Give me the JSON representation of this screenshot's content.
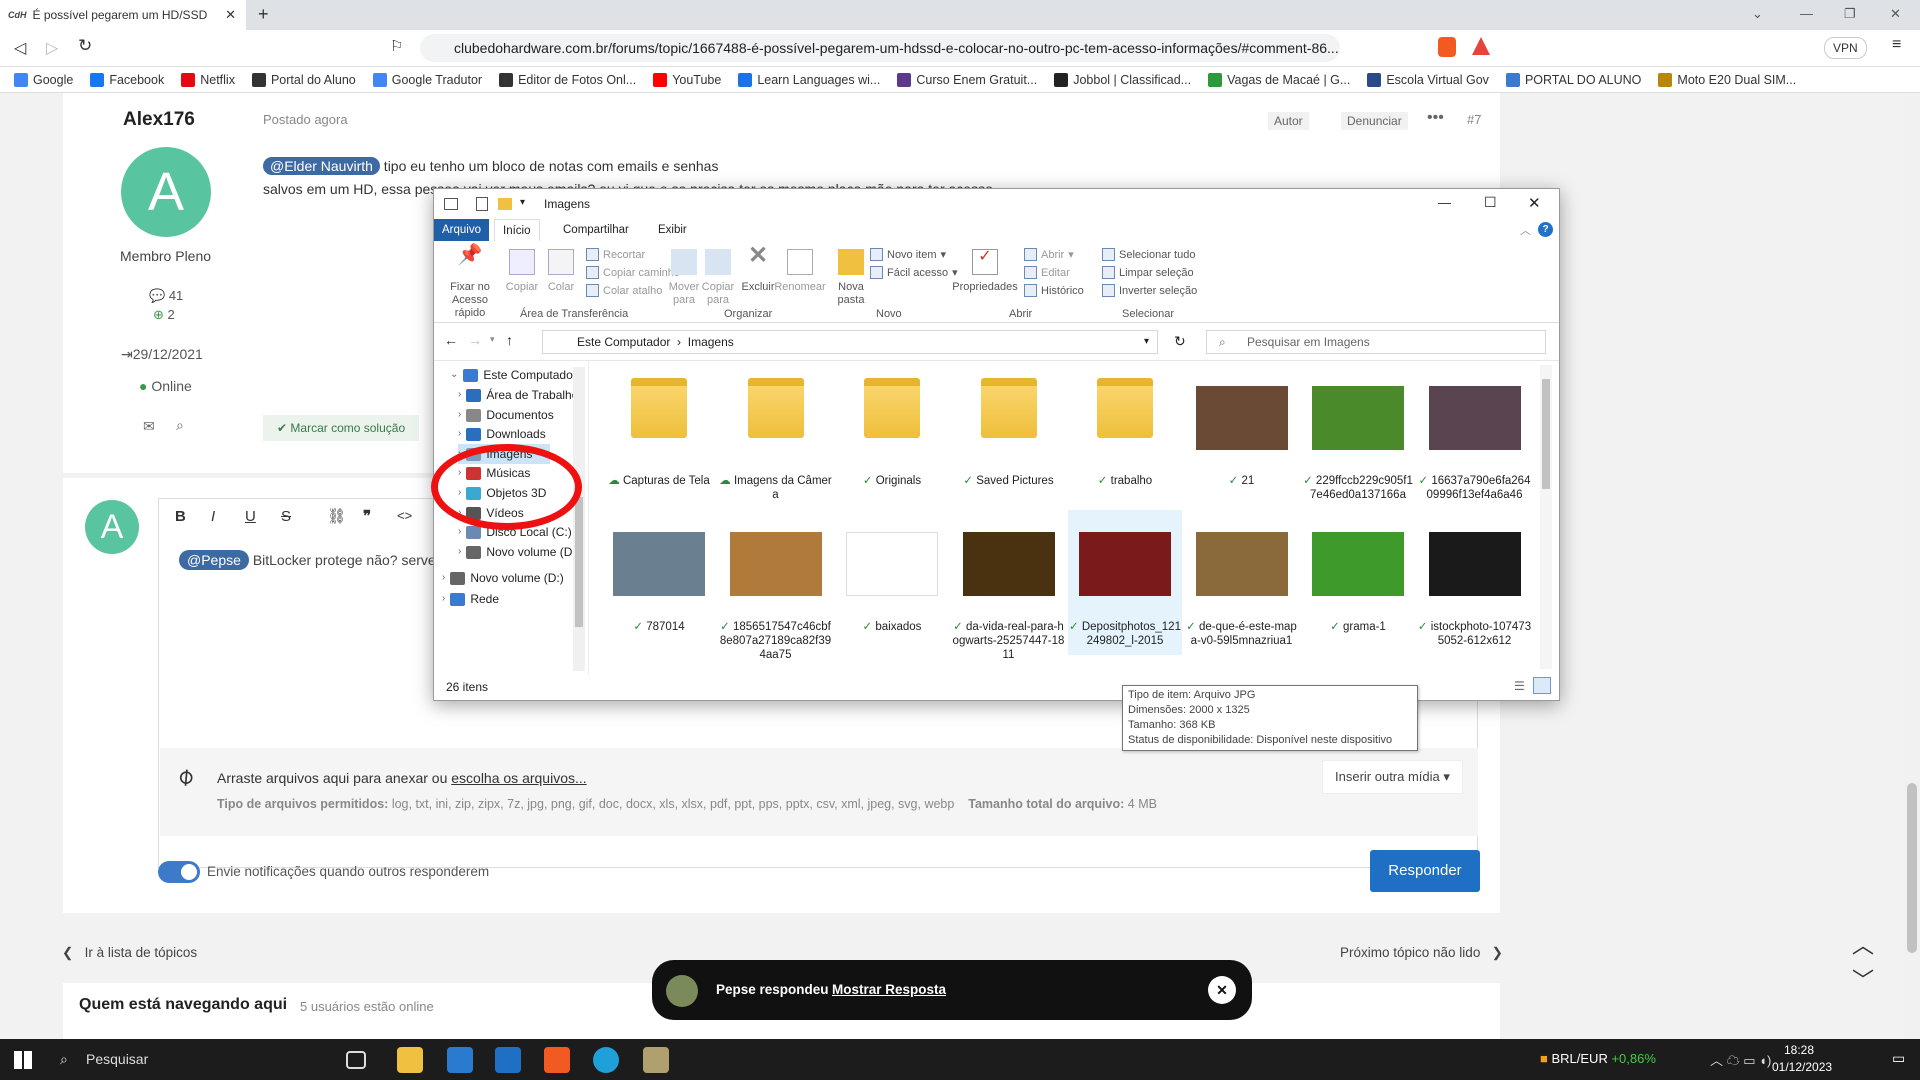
{
  "browser": {
    "tab_title": "É possível pegarem um HD/SSD",
    "favicon": "CdH",
    "url": "clubedohardware.com.br/forums/topic/1667488-é-possível-pegarem-um-hdssd-e-colocar-no-outro-pc-tem-acesso-informações/#comment-86...",
    "vpn": "VPN",
    "bookmarks": [
      "Google",
      "Facebook",
      "Netflix",
      "Portal do Aluno",
      "Google Tradutor",
      "Editor de Fotos Onl...",
      "YouTube",
      "Learn Languages wi...",
      "Curso Enem Gratuit...",
      "Jobbol | Classificad...",
      "Vagas de Macaé | G...",
      "Escola Virtual Gov",
      "PORTAL DO ALUNO",
      "Moto E20 Dual SIM..."
    ]
  },
  "post": {
    "author": "Alex176",
    "avatar_letter": "A",
    "role": "Membro Pleno",
    "posts": "41",
    "reputation": "2",
    "joined": "29/12/2021",
    "status": "Online",
    "posted": "Postado agora",
    "author_badge": "Autor",
    "report": "Denunciar",
    "number": "#7",
    "mention": "@Elder Nauvirth",
    "line1": " tipo eu tenho um bloco de notas com emails e senhas",
    "line2": "salvos em um HD, essa pessoa vai ver meus emails? ou vi que e so precisa ter os mesmo placa mãe para ter acesso",
    "solution_btn": "Marcar como solução"
  },
  "reply": {
    "avatar_letter": "A",
    "mention": "@Pepse",
    "text": "BitLocker protege não? serve",
    "attach_text": "Arraste arquivos aqui para anexar ou ",
    "attach_link": "escolha os arquivos...",
    "allowed_label": "Tipo de arquivos permitidos:",
    "allowed": "log, txt, ini, zip, zipx, 7z, jpg, png, gif, doc, docx, xls, xlsx, pdf, ppt, pps, pptx, csv, xml, jpeg, svg, webp",
    "size_label": "Tamanho total do arquivo:",
    "size": "4 MB",
    "insert_media": "Inserir outra mídia",
    "notify": "Envie notificações quando outros responderem",
    "submit": "Responder"
  },
  "footer_nav": {
    "back": "Ir à lista de tópicos",
    "next": "Próximo tópico não lido"
  },
  "browsing": {
    "title": "Quem está navegando aqui",
    "count": "5 usuários estão online"
  },
  "toast": {
    "text": "Pepse respondeu",
    "link": "Mostrar Resposta"
  },
  "explorer": {
    "title": "Imagens",
    "tabs": [
      "Arquivo",
      "Início",
      "Compartilhar",
      "Exibir"
    ],
    "ribbon": {
      "pin": "Fixar no Acesso rápido",
      "copy": "Copiar",
      "paste": "Colar",
      "cut": "Recortar",
      "copy_path": "Copiar caminho",
      "paste_shortcut": "Colar atalho",
      "clipboard": "Área de Transferência",
      "move": "Mover para",
      "copyto": "Copiar para",
      "delete": "Excluir",
      "rename": "Renomear",
      "organize": "Organizar",
      "newfolder": "Nova pasta",
      "newitem": "Novo item",
      "easy": "Fácil acesso",
      "new": "Novo",
      "props": "Propriedades",
      "open": "Abrir",
      "edit": "Editar",
      "history": "Histórico",
      "open_grp": "Abrir",
      "selall": "Selecionar tudo",
      "selnone": "Limpar seleção",
      "selinv": "Inverter seleção",
      "select": "Selecionar"
    },
    "crumbs": [
      "Este Computador",
      "Imagens"
    ],
    "search": "Pesquisar em Imagens",
    "tree": [
      "Este Computador",
      "Área de Trabalho",
      "Documentos",
      "Downloads",
      "Imagens",
      "Músicas",
      "Objetos 3D",
      "Vídeos",
      "Disco Local (C:)",
      "Novo volume (D:",
      "Novo volume (D:)",
      "Rede"
    ],
    "items": [
      {
        "name": "Capturas de Tela",
        "kind": "folder"
      },
      {
        "name": "Imagens da Câmera",
        "kind": "folder"
      },
      {
        "name": "Originals",
        "kind": "folder"
      },
      {
        "name": "Saved Pictures",
        "kind": "folder"
      },
      {
        "name": "trabalho",
        "kind": "folder"
      },
      {
        "name": "21",
        "kind": "photo",
        "color": "#6b4a35"
      },
      {
        "name": "229ffccb229c905f17e46ed0a137166a",
        "kind": "photo",
        "color": "#4a8a2a"
      },
      {
        "name": "16637a790e6fa26409996f13ef4a6a46",
        "kind": "photo",
        "color": "#5a4450"
      },
      {
        "name": "787014",
        "kind": "photo",
        "color": "#6a7f90"
      },
      {
        "name": "1856517547c46cbf8e807a27189ca82f394aa75",
        "kind": "photo",
        "color": "#b07a3a"
      },
      {
        "name": "baixados",
        "kind": "photo",
        "color": "#ffffff"
      },
      {
        "name": "da-vida-real-para-hogwarts-25257447-1811",
        "kind": "photo",
        "color": "#4a3210"
      },
      {
        "name": "Depositphotos_121249802_l-2015",
        "kind": "photo",
        "color": "#7a1a1a"
      },
      {
        "name": "de-que-é-este-mapa-v0-59l5mnazriua1",
        "kind": "photo",
        "color": "#8a6a3a"
      },
      {
        "name": "grama-1",
        "kind": "photo",
        "color": "#3e9a2a"
      },
      {
        "name": "istockphoto-1074735052-612x612",
        "kind": "photo",
        "color": "#1a1a1a"
      }
    ],
    "status": "26 itens"
  },
  "tooltip": {
    "type": "Tipo de item: Arquivo JPG",
    "dims": "Dimensões: 2000 x 1325",
    "size": "Tamanho: 368 KB",
    "avail": "Status de disponibilidade: Disponível neste dispositivo"
  },
  "taskbar": {
    "search": "Pesquisar",
    "currency": "BRL/EUR",
    "change": "+0,86%",
    "time": "18:28",
    "date": "01/12/2023"
  }
}
